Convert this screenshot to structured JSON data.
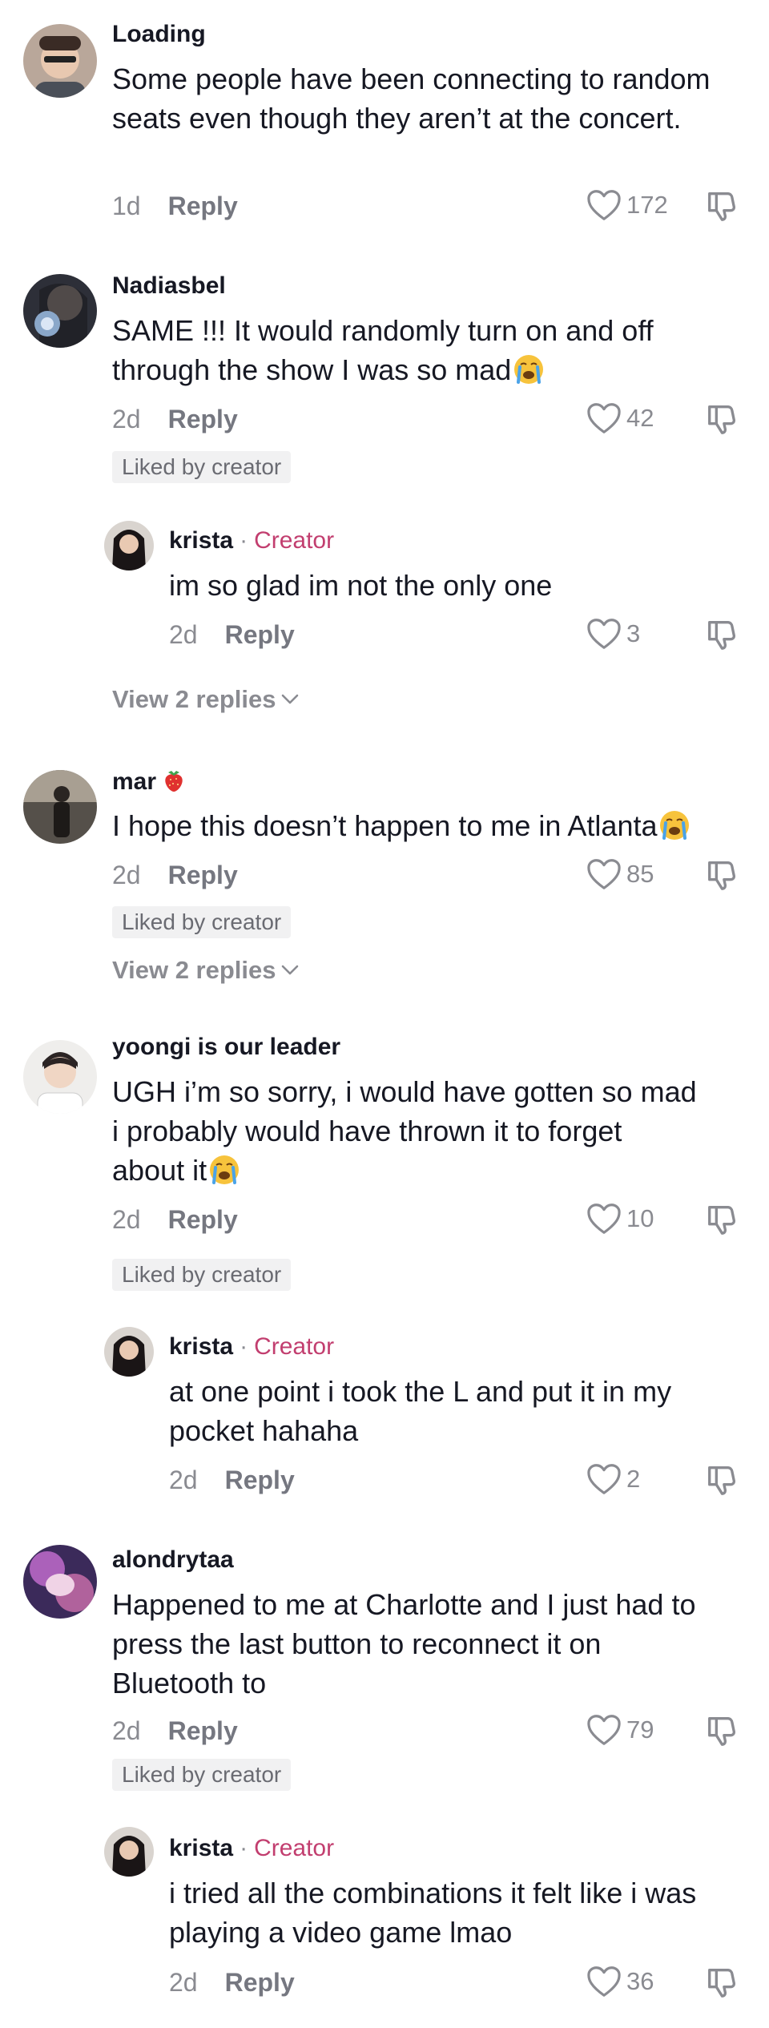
{
  "comments": [
    {
      "username": "Loading",
      "text": "Some people have been connecting to random seats even though they aren’t at the concert.",
      "time": "1d",
      "reply_label": "Reply",
      "likes": "172",
      "liked_by_creator": false
    },
    {
      "username": "Nadiasbel",
      "text": "SAME !!! It would randomly turn on and off through the show I was so mad",
      "emoji": "crying-face",
      "time": "2d",
      "reply_label": "Reply",
      "likes": "42",
      "liked_by_creator": true,
      "liked_label": "Liked by creator",
      "replies": [
        {
          "username": "krista",
          "badge": "Creator",
          "text": "im so glad im not the only one",
          "time": "2d",
          "reply_label": "Reply",
          "likes": "3"
        }
      ],
      "view_replies": "View 2 replies"
    },
    {
      "username": "mar",
      "username_emoji": "strawberry",
      "text": "I hope this doesn’t happen to me in Atlanta",
      "emoji": "crying-face",
      "time": "2d",
      "reply_label": "Reply",
      "likes": "85",
      "liked_by_creator": true,
      "liked_label": "Liked by creator",
      "view_replies": "View 2 replies"
    },
    {
      "username": "yoongi is our leader",
      "text_lines": [
        "UGH i’m so sorry, i would have gotten so mad",
        "i probably would have thrown it to forget",
        "about it"
      ],
      "emoji": "crying-face",
      "time": "2d",
      "reply_label": "Reply",
      "likes": "10",
      "liked_by_creator": true,
      "liked_label": "Liked by creator",
      "replies": [
        {
          "username": "krista",
          "badge": "Creator",
          "text_lines": [
            "at one point i took the L and put it in my",
            "pocket hahaha"
          ],
          "time": "2d",
          "reply_label": "Reply",
          "likes": "2"
        }
      ]
    },
    {
      "username": "alondrytaa",
      "text_lines": [
        "Happened to me at Charlotte and I just had to",
        "press the last button to reconnect it on",
        "Bluetooth to"
      ],
      "time": "2d",
      "reply_label": "Reply",
      "likes": "79",
      "liked_by_creator": true,
      "liked_label": "Liked by creator",
      "replies": [
        {
          "username": "krista",
          "badge": "Creator",
          "text_lines": [
            "i tried all the combinations it felt like i was",
            "playing a video game lmao"
          ],
          "time": "2d",
          "reply_label": "Reply",
          "likes": "36"
        }
      ]
    }
  ],
  "colors": {
    "text": "#161823",
    "muted": "#8a8b91",
    "creator": "#c23e6f",
    "chip_bg": "#f1f1f2"
  },
  "icons": {
    "like": "heart-outline-icon",
    "dislike": "thumbs-down-icon",
    "expand": "chevron-down-icon"
  }
}
